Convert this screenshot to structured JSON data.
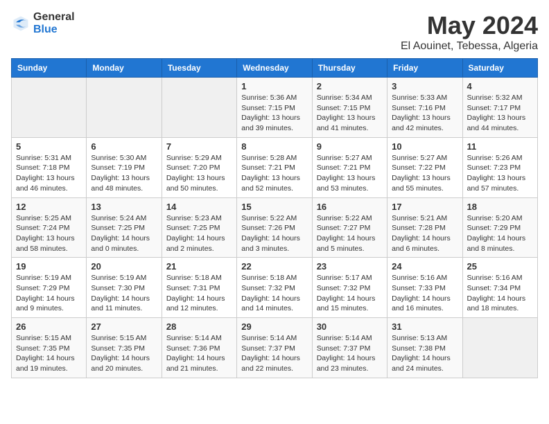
{
  "header": {
    "logo_general": "General",
    "logo_blue": "Blue",
    "month_title": "May 2024",
    "location": "El Aouinet, Tebessa, Algeria"
  },
  "days_of_week": [
    "Sunday",
    "Monday",
    "Tuesday",
    "Wednesday",
    "Thursday",
    "Friday",
    "Saturday"
  ],
  "weeks": [
    [
      {
        "day": "",
        "info": ""
      },
      {
        "day": "",
        "info": ""
      },
      {
        "day": "",
        "info": ""
      },
      {
        "day": "1",
        "info": "Sunrise: 5:36 AM\nSunset: 7:15 PM\nDaylight: 13 hours\nand 39 minutes."
      },
      {
        "day": "2",
        "info": "Sunrise: 5:34 AM\nSunset: 7:15 PM\nDaylight: 13 hours\nand 41 minutes."
      },
      {
        "day": "3",
        "info": "Sunrise: 5:33 AM\nSunset: 7:16 PM\nDaylight: 13 hours\nand 42 minutes."
      },
      {
        "day": "4",
        "info": "Sunrise: 5:32 AM\nSunset: 7:17 PM\nDaylight: 13 hours\nand 44 minutes."
      }
    ],
    [
      {
        "day": "5",
        "info": "Sunrise: 5:31 AM\nSunset: 7:18 PM\nDaylight: 13 hours\nand 46 minutes."
      },
      {
        "day": "6",
        "info": "Sunrise: 5:30 AM\nSunset: 7:19 PM\nDaylight: 13 hours\nand 48 minutes."
      },
      {
        "day": "7",
        "info": "Sunrise: 5:29 AM\nSunset: 7:20 PM\nDaylight: 13 hours\nand 50 minutes."
      },
      {
        "day": "8",
        "info": "Sunrise: 5:28 AM\nSunset: 7:21 PM\nDaylight: 13 hours\nand 52 minutes."
      },
      {
        "day": "9",
        "info": "Sunrise: 5:27 AM\nSunset: 7:21 PM\nDaylight: 13 hours\nand 53 minutes."
      },
      {
        "day": "10",
        "info": "Sunrise: 5:27 AM\nSunset: 7:22 PM\nDaylight: 13 hours\nand 55 minutes."
      },
      {
        "day": "11",
        "info": "Sunrise: 5:26 AM\nSunset: 7:23 PM\nDaylight: 13 hours\nand 57 minutes."
      }
    ],
    [
      {
        "day": "12",
        "info": "Sunrise: 5:25 AM\nSunset: 7:24 PM\nDaylight: 13 hours\nand 58 minutes."
      },
      {
        "day": "13",
        "info": "Sunrise: 5:24 AM\nSunset: 7:25 PM\nDaylight: 14 hours\nand 0 minutes."
      },
      {
        "day": "14",
        "info": "Sunrise: 5:23 AM\nSunset: 7:25 PM\nDaylight: 14 hours\nand 2 minutes."
      },
      {
        "day": "15",
        "info": "Sunrise: 5:22 AM\nSunset: 7:26 PM\nDaylight: 14 hours\nand 3 minutes."
      },
      {
        "day": "16",
        "info": "Sunrise: 5:22 AM\nSunset: 7:27 PM\nDaylight: 14 hours\nand 5 minutes."
      },
      {
        "day": "17",
        "info": "Sunrise: 5:21 AM\nSunset: 7:28 PM\nDaylight: 14 hours\nand 6 minutes."
      },
      {
        "day": "18",
        "info": "Sunrise: 5:20 AM\nSunset: 7:29 PM\nDaylight: 14 hours\nand 8 minutes."
      }
    ],
    [
      {
        "day": "19",
        "info": "Sunrise: 5:19 AM\nSunset: 7:29 PM\nDaylight: 14 hours\nand 9 minutes."
      },
      {
        "day": "20",
        "info": "Sunrise: 5:19 AM\nSunset: 7:30 PM\nDaylight: 14 hours\nand 11 minutes."
      },
      {
        "day": "21",
        "info": "Sunrise: 5:18 AM\nSunset: 7:31 PM\nDaylight: 14 hours\nand 12 minutes."
      },
      {
        "day": "22",
        "info": "Sunrise: 5:18 AM\nSunset: 7:32 PM\nDaylight: 14 hours\nand 14 minutes."
      },
      {
        "day": "23",
        "info": "Sunrise: 5:17 AM\nSunset: 7:32 PM\nDaylight: 14 hours\nand 15 minutes."
      },
      {
        "day": "24",
        "info": "Sunrise: 5:16 AM\nSunset: 7:33 PM\nDaylight: 14 hours\nand 16 minutes."
      },
      {
        "day": "25",
        "info": "Sunrise: 5:16 AM\nSunset: 7:34 PM\nDaylight: 14 hours\nand 18 minutes."
      }
    ],
    [
      {
        "day": "26",
        "info": "Sunrise: 5:15 AM\nSunset: 7:35 PM\nDaylight: 14 hours\nand 19 minutes."
      },
      {
        "day": "27",
        "info": "Sunrise: 5:15 AM\nSunset: 7:35 PM\nDaylight: 14 hours\nand 20 minutes."
      },
      {
        "day": "28",
        "info": "Sunrise: 5:14 AM\nSunset: 7:36 PM\nDaylight: 14 hours\nand 21 minutes."
      },
      {
        "day": "29",
        "info": "Sunrise: 5:14 AM\nSunset: 7:37 PM\nDaylight: 14 hours\nand 22 minutes."
      },
      {
        "day": "30",
        "info": "Sunrise: 5:14 AM\nSunset: 7:37 PM\nDaylight: 14 hours\nand 23 minutes."
      },
      {
        "day": "31",
        "info": "Sunrise: 5:13 AM\nSunset: 7:38 PM\nDaylight: 14 hours\nand 24 minutes."
      },
      {
        "day": "",
        "info": ""
      }
    ]
  ]
}
